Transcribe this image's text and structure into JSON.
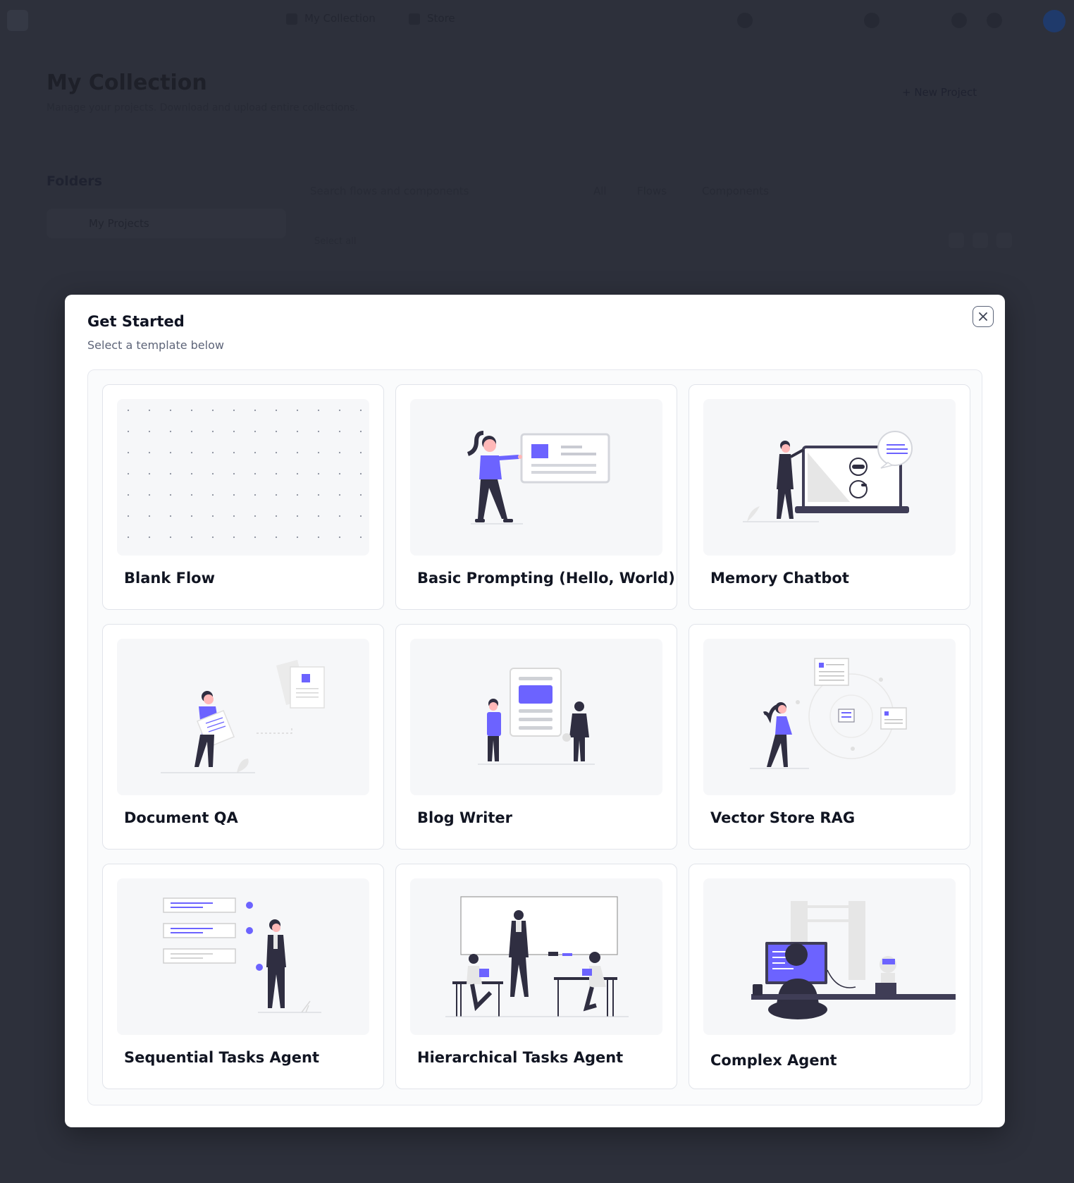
{
  "background": {
    "breadcrumb_collection": "My Collection",
    "breadcrumb_store": "Store",
    "page_title": "My Collection",
    "page_subtitle": "Manage your projects. Download and upload entire collections.",
    "new_project": "+ New Project",
    "folders_heading": "Folders",
    "folder_item": "My Projects",
    "search_placeholder": "Search flows and components",
    "tab_all": "All",
    "tab_flows": "Flows",
    "tab_components": "Components",
    "select_all": "Select all"
  },
  "modal": {
    "title": "Get Started",
    "subtitle": "Select a template below",
    "close_icon": "close-icon",
    "templates": [
      {
        "label": "Blank Flow",
        "illustration": "dot-grid"
      },
      {
        "label": "Basic Prompting (Hello, World)",
        "illustration": "woman-presenting-card"
      },
      {
        "label": "Memory Chatbot",
        "illustration": "woman-with-laptop-robot"
      },
      {
        "label": "Document QA",
        "illustration": "man-carrying-document"
      },
      {
        "label": "Blog Writer",
        "illustration": "people-with-blog-page"
      },
      {
        "label": "Vector Store RAG",
        "illustration": "woman-with-floating-docs"
      },
      {
        "label": "Sequential Tasks Agent",
        "illustration": "man-with-checklist"
      },
      {
        "label": "Hierarchical Tasks Agent",
        "illustration": "team-meeting-board"
      },
      {
        "label": "Complex Agent",
        "illustration": "person-at-computer"
      }
    ]
  },
  "colors": {
    "accent": "#6c63ff",
    "dark": "#2f2e41",
    "overlay": "#2d303b"
  }
}
